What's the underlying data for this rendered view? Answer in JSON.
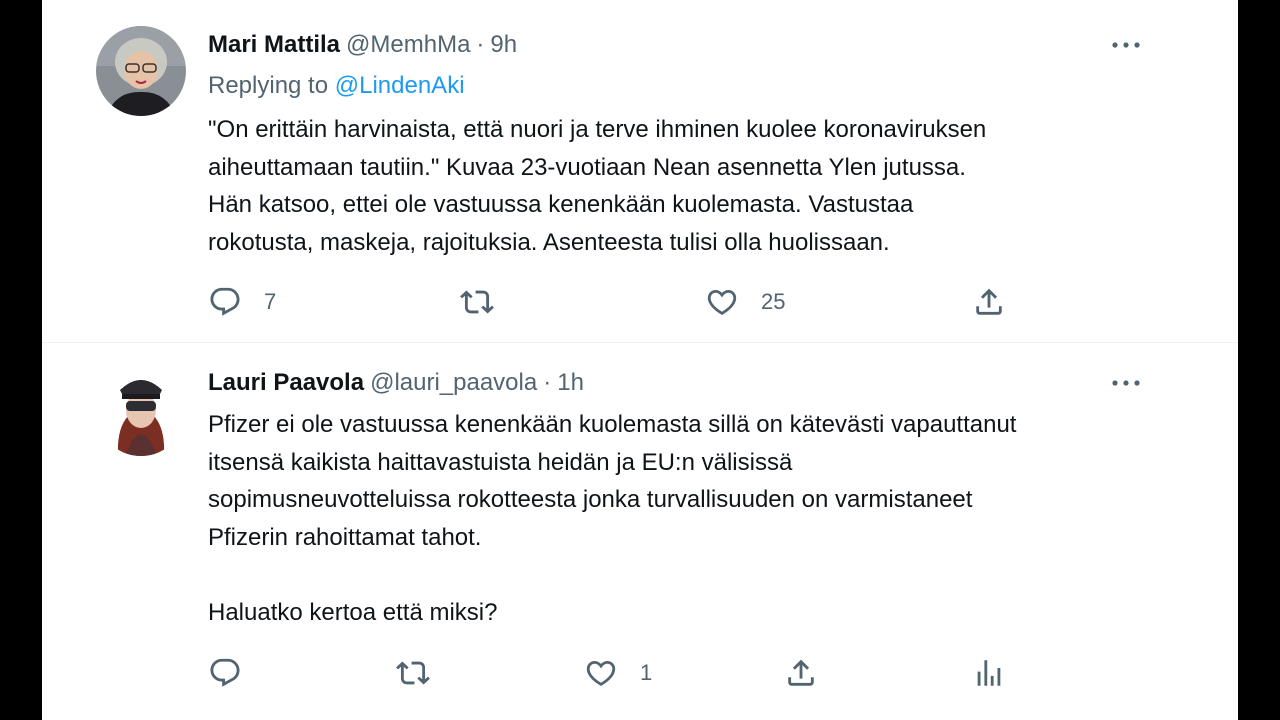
{
  "tweets": [
    {
      "author_name": "Mari Mattila",
      "handle": "@MemhMa",
      "separator": "·",
      "time": "9h",
      "replying_prefix": "Replying to",
      "replying_to": "@LindenAki",
      "text": "\"On erittäin harvinaista, että nuori ja terve ihminen kuolee koronaviruksen\naiheuttamaan tautiin.\" Kuvaa 23-vuotiaan Nean asennetta Ylen jutussa.\nHän katsoo, ettei ole vastuussa kenenkään kuolemasta. Vastustaa\nrokotusta, maskeja, rajoituksia. Asenteesta tulisi olla huolissaan.",
      "replies": "7",
      "retweets": "",
      "likes": "25"
    },
    {
      "author_name": "Lauri Paavola",
      "handle": "@lauri_paavola",
      "separator": "·",
      "time": "1h",
      "text": "Pfizer ei ole vastuussa kenenkään kuolemasta sillä on kätevästi vapauttanut\nitsensä kaikista haittavastuista heidän ja EU:n välisissä\nsopimusneuvotteluissa rokotteesta jonka turvallisuuden on varmistaneet\nPfizerin rahoittamat tahot.\n\nHaluatko kertoa että miksi?",
      "replies": "",
      "retweets": "",
      "likes": "1"
    }
  ],
  "colors": {
    "text_primary": "#0f1419",
    "text_secondary": "#536471",
    "link": "#1d9bf0",
    "divider": "#eff3f4"
  },
  "icons": {
    "reply": "reply-icon",
    "retweet": "retweet-icon",
    "like": "heart-icon",
    "share": "share-icon",
    "analytics": "analytics-icon",
    "more": "more-icon"
  }
}
